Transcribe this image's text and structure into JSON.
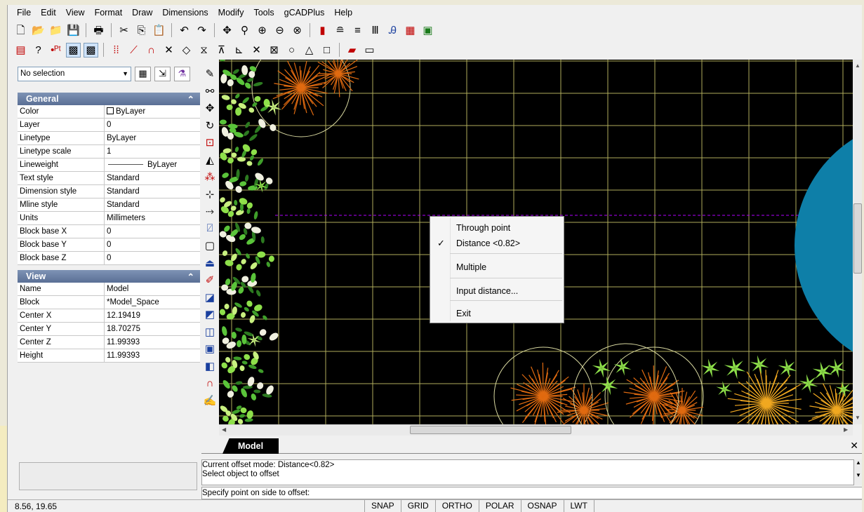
{
  "menu": [
    "File",
    "Edit",
    "View",
    "Format",
    "Draw",
    "Dimensions",
    "Modify",
    "Tools",
    "gCADPlus",
    "Help"
  ],
  "toolbar1": [
    {
      "icon": "new-file-icon",
      "glyph": "🗋"
    },
    {
      "icon": "open-folder-icon",
      "glyph": "📂"
    },
    {
      "icon": "open-template-icon",
      "glyph": "📁"
    },
    {
      "icon": "save-icon",
      "glyph": "💾"
    },
    {
      "sep": true
    },
    {
      "icon": "print-icon",
      "glyph": "🖶"
    },
    {
      "sep": true
    },
    {
      "icon": "cut-icon",
      "glyph": "✂"
    },
    {
      "icon": "copy-icon",
      "glyph": "⎘"
    },
    {
      "icon": "paste-icon",
      "glyph": "📋"
    },
    {
      "sep": true
    },
    {
      "icon": "undo-icon",
      "glyph": "↶"
    },
    {
      "icon": "redo-icon",
      "glyph": "↷"
    },
    {
      "sep": true
    },
    {
      "icon": "pan-icon",
      "glyph": "✥"
    },
    {
      "icon": "zoom-realtime-icon",
      "glyph": "⚲"
    },
    {
      "icon": "zoom-window-icon",
      "glyph": "⊕"
    },
    {
      "icon": "zoom-previous-icon",
      "glyph": "⊖"
    },
    {
      "icon": "zoom-extents-icon",
      "glyph": "⊗"
    },
    {
      "sep": true
    },
    {
      "icon": "color-icon",
      "glyph": "▮",
      "cls": "c-red"
    },
    {
      "icon": "layer-icon",
      "glyph": "≘"
    },
    {
      "icon": "linetype-icon",
      "glyph": "≡"
    },
    {
      "icon": "lineweight-icon",
      "glyph": "Ⅲ"
    },
    {
      "icon": "text-style-icon",
      "glyph": "Ꭿ",
      "cls": "c-blue"
    },
    {
      "icon": "dimension-style-icon",
      "glyph": "▦",
      "cls": "c-red"
    },
    {
      "icon": "image-manager-icon",
      "glyph": "▣",
      "cls": "c-green"
    }
  ],
  "toolbar2": [
    {
      "icon": "layer-manager-icon",
      "glyph": "▤",
      "cls": "c-red"
    },
    {
      "icon": "help-icon",
      "glyph": "?"
    },
    {
      "icon": "point-icon",
      "glyph": "•ᴾᵗ",
      "cls": "c-red"
    },
    {
      "icon": "snap-toggle-icon",
      "glyph": "▩",
      "pressed": true
    },
    {
      "icon": "grid-toggle-icon",
      "glyph": "▩",
      "pressed": true
    },
    {
      "sep": true
    },
    {
      "icon": "snap-grid-icon",
      "glyph": "⁞⁞",
      "cls": "c-red"
    },
    {
      "icon": "snap-endpoint-icon",
      "glyph": "⟋",
      "cls": "c-red"
    },
    {
      "icon": "magnet-icon",
      "glyph": "∩",
      "cls": "c-red"
    },
    {
      "icon": "clear-snaps-icon",
      "glyph": "✕"
    },
    {
      "icon": "snap-nearest-icon",
      "glyph": "◇"
    },
    {
      "icon": "snap-midpoint-icon",
      "glyph": "⧖"
    },
    {
      "icon": "snap-center-icon",
      "glyph": "⊼"
    },
    {
      "icon": "snap-perpendicular-icon",
      "glyph": "⊾"
    },
    {
      "icon": "snap-intersection-icon",
      "glyph": "✕"
    },
    {
      "icon": "snap-apparent-icon",
      "glyph": "⊠"
    },
    {
      "icon": "snap-quadrant-icon",
      "glyph": "○"
    },
    {
      "icon": "snap-tangent-icon",
      "glyph": "△"
    },
    {
      "icon": "snap-node-icon",
      "glyph": "□"
    },
    {
      "sep": true
    },
    {
      "icon": "draw-order-icon",
      "glyph": "▰",
      "cls": "c-red"
    },
    {
      "icon": "underline-icon",
      "glyph": "▭"
    }
  ],
  "selection": {
    "value": "No selection"
  },
  "selection_buttons": [
    "select-all-icon",
    "quick-select-icon",
    "filter-icon"
  ],
  "general": {
    "title": "General",
    "rows": [
      {
        "name": "Color",
        "value": "ByLayer",
        "swatch": true
      },
      {
        "name": "Layer",
        "value": "0"
      },
      {
        "name": "Linetype",
        "value": "ByLayer"
      },
      {
        "name": "Linetype scale",
        "value": "1"
      },
      {
        "name": "Lineweight",
        "value": "ByLayer",
        "lineweight": true
      },
      {
        "name": "Text style",
        "value": "Standard"
      },
      {
        "name": "Dimension style",
        "value": "Standard"
      },
      {
        "name": "Mline style",
        "value": "Standard"
      },
      {
        "name": "Units",
        "value": "Millimeters"
      },
      {
        "name": "Block base X",
        "value": "0"
      },
      {
        "name": "Block base Y",
        "value": "0"
      },
      {
        "name": "Block base Z",
        "value": "0"
      }
    ]
  },
  "view": {
    "title": "View",
    "rows": [
      {
        "name": "Name",
        "value": "Model"
      },
      {
        "name": "Block",
        "value": "*Model_Space"
      },
      {
        "name": "Center X",
        "value": "12.19419"
      },
      {
        "name": "Center Y",
        "value": "18.70275"
      },
      {
        "name": "Center Z",
        "value": "11.99393"
      },
      {
        "name": "Height",
        "value": "11.99393"
      }
    ]
  },
  "vtoolbar": [
    {
      "icon": "erase-icon",
      "glyph": "✎"
    },
    {
      "icon": "copy-object-icon",
      "glyph": "⚯"
    },
    {
      "icon": "move-icon",
      "glyph": "✥"
    },
    {
      "icon": "rotate-icon",
      "glyph": "↻"
    },
    {
      "icon": "scale-icon",
      "glyph": "⊡",
      "cls": "c-red"
    },
    {
      "icon": "mirror-icon",
      "glyph": "◭"
    },
    {
      "icon": "explode-icon",
      "glyph": "⁂",
      "cls": "c-red"
    },
    {
      "icon": "trim-icon",
      "glyph": "⊹"
    },
    {
      "icon": "extend-icon",
      "glyph": "⤑"
    },
    {
      "icon": "stretch-icon",
      "glyph": "⍁",
      "cls": "c-blue"
    },
    {
      "icon": "rectangle-icon",
      "glyph": "▢"
    },
    {
      "icon": "offset-icon",
      "glyph": "⏏",
      "cls": "c-blue"
    },
    {
      "icon": "spray-icon",
      "glyph": "✐",
      "cls": "c-red"
    },
    {
      "icon": "bring-front-icon",
      "glyph": "◪",
      "cls": "c-blue"
    },
    {
      "icon": "send-back-icon",
      "glyph": "◩",
      "cls": "c-blue"
    },
    {
      "icon": "group-front-icon",
      "glyph": "◫",
      "cls": "c-blue"
    },
    {
      "icon": "group-back-icon",
      "glyph": "▣",
      "cls": "c-blue"
    },
    {
      "icon": "insert-block-icon",
      "glyph": "◧",
      "cls": "c-blue"
    },
    {
      "icon": "magnet-snap-icon",
      "glyph": "∩",
      "cls": "c-red"
    },
    {
      "icon": "hatch-icon",
      "glyph": "✍",
      "cls": "c-orange"
    }
  ],
  "context_menu": {
    "items": [
      {
        "label": "Through point",
        "checked": false
      },
      {
        "label": "Distance <0.82>",
        "checked": true
      },
      {
        "label": "Multiple",
        "checked": false
      },
      {
        "label": "Input distance...",
        "checked": false
      },
      {
        "label": "Exit",
        "checked": false
      }
    ]
  },
  "model_tab": "Model",
  "command_history": [
    "Current offset mode:  Distance<0.82>",
    "Select object to offset"
  ],
  "command_prompt": "Specify point on side to offset:",
  "status": {
    "coords": "8.56, 19.65",
    "toggles": [
      "SNAP",
      "GRID",
      "ORTHO",
      "POLAR",
      "OSNAP",
      "LWT"
    ]
  },
  "colors": {
    "grid": "#b0ad5c",
    "circle": "#0e7fa8",
    "tree_orange": "#e06a10",
    "leaf_green": "#8ee04a",
    "dashed": "#b000ff"
  }
}
